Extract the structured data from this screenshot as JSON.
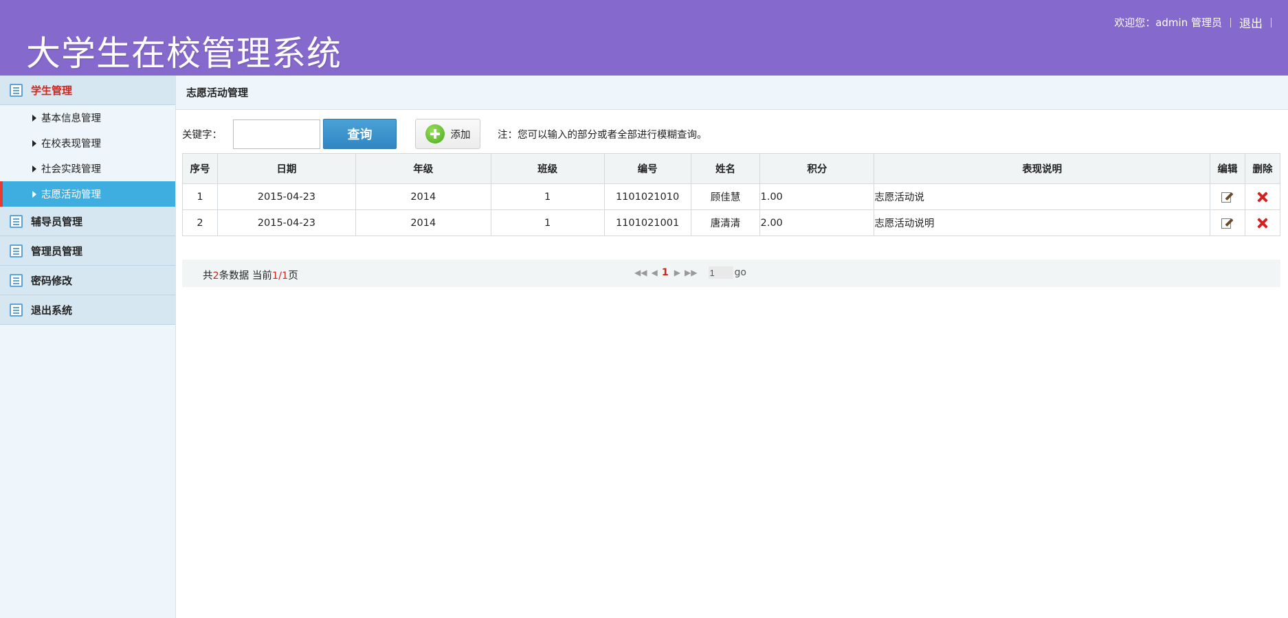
{
  "app": {
    "title": "大学生在校管理系统",
    "welcome": "欢迎您：admin 管理员",
    "logout": "退出"
  },
  "sidebar": {
    "groups": [
      {
        "label": "学生管理",
        "active": true
      },
      {
        "label": "辅导员管理"
      },
      {
        "label": "管理员管理"
      },
      {
        "label": "密码修改"
      },
      {
        "label": "退出系统"
      }
    ],
    "student_items": [
      {
        "label": "基本信息管理"
      },
      {
        "label": "在校表现管理"
      },
      {
        "label": "社会实践管理"
      },
      {
        "label": "志愿活动管理",
        "active": true
      }
    ]
  },
  "main": {
    "breadcrumb": "志愿活动管理",
    "search": {
      "label": "关键字：",
      "value": "",
      "query_button": "查询",
      "add_button": "添加",
      "note": "注：您可以输入的部分或者全部进行模糊查询。"
    },
    "table": {
      "headers": [
        "序号",
        "日期",
        "年级",
        "班级",
        "编号",
        "姓名",
        "积分",
        "表现说明",
        "编辑",
        "删除"
      ],
      "rows": [
        {
          "no": "1",
          "date": "2015-04-23",
          "grade": "2014",
          "class": "1",
          "id": "1101021010",
          "name": "顾佳慧",
          "score": "1.00",
          "desc": "志愿活动说"
        },
        {
          "no": "2",
          "date": "2015-04-23",
          "grade": "2014",
          "class": "1",
          "id": "1101021001",
          "name": "唐清清",
          "score": "2.00",
          "desc": "志愿活动说明"
        }
      ]
    },
    "pager": {
      "prefix": "共",
      "total": "2",
      "mid": "条数据 当前",
      "current": "1/1",
      "suffix": "页",
      "first": "◀◀",
      "prev": "◀",
      "page": "1",
      "next": "▶",
      "last": "▶▶",
      "input_value": "1",
      "go": "go"
    }
  },
  "colors": {
    "header_bg": "#8669cc",
    "active_item_bg": "#3eaee1",
    "accent_red": "#d0241b",
    "query_button": "#3a93cf"
  }
}
